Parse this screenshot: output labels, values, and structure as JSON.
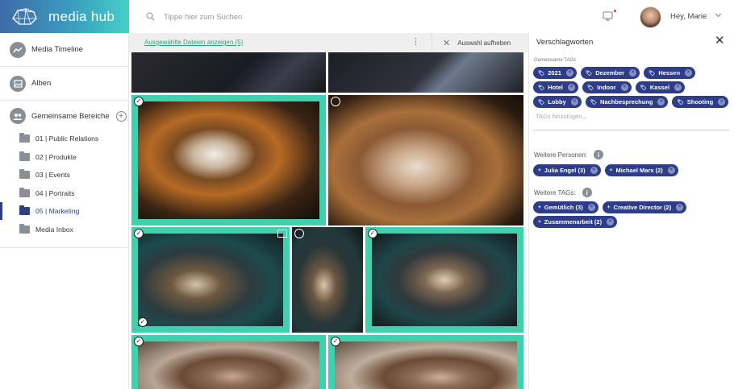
{
  "app": {
    "name": "media hub"
  },
  "search": {
    "placeholder": "Tippe hier zum Suchen"
  },
  "user": {
    "greeting": "Hey, Marie"
  },
  "sidebar": {
    "items": [
      {
        "label": "Media Timeline",
        "icon": "timeline-icon"
      },
      {
        "label": "Alben",
        "icon": "album-icon"
      }
    ],
    "group": {
      "label": "Gemeinsame Bereiche",
      "icon": "people-icon"
    },
    "folders": [
      {
        "label": "01 | Public Relations",
        "active": false
      },
      {
        "label": "02 | Produkte",
        "active": false
      },
      {
        "label": "03 | Events",
        "active": false
      },
      {
        "label": "04 | Portraits",
        "active": false
      },
      {
        "label": "05 | Marketing",
        "active": true
      },
      {
        "label": "Media Inbox",
        "active": false
      }
    ]
  },
  "actionbar": {
    "show_selected": "Ausgewählte Dateien anzeigen (5)",
    "kebab": "⋮",
    "deselect": "Auswahl aufheben"
  },
  "panel": {
    "title": "Verschlagworten",
    "common_tags_label": "Gemeinsame TAGs",
    "common_tags": [
      "2021",
      "Dezember",
      "Hessen",
      "Hotel",
      "Indoor",
      "Kassel",
      "Lobby",
      "Nachbesprechung",
      "Shooting"
    ],
    "tag_input_placeholder": "TAGs hinzufügen...",
    "persons_label": "Weitere Personen:",
    "persons": [
      "Julia Engel (3)",
      "Michael Marx (2)"
    ],
    "more_tags_label": "Weitere TAGs:",
    "more_tags": [
      "Gemütlich (3)",
      "Creative Director (2)",
      "Zusammenarbeit (2)"
    ]
  },
  "colors": {
    "accent": "#2d3d8a",
    "selection": "#3fd0ae",
    "link": "#2ea37a"
  },
  "grid": {
    "tiles": [
      {
        "name": "photo-top-left-partial",
        "selected": false
      },
      {
        "name": "photo-top-right-partial",
        "selected": false
      },
      {
        "name": "photo-woman-portrait",
        "selected": true
      },
      {
        "name": "photo-woman-drinking",
        "selected": false
      },
      {
        "name": "photo-lounge-wide",
        "selected": true
      },
      {
        "name": "photo-lounge-tall",
        "selected": false
      },
      {
        "name": "photo-lounge-right",
        "selected": true
      },
      {
        "name": "photo-man-left",
        "selected": true
      },
      {
        "name": "photo-man-right",
        "selected": true
      }
    ]
  }
}
